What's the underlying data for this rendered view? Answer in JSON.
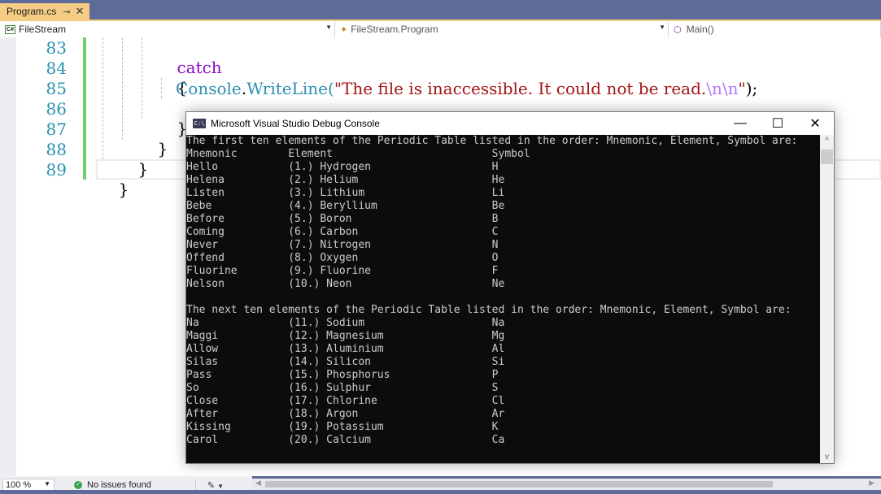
{
  "tab": {
    "label": "Program.cs",
    "pin_icon": "pin-icon",
    "close_icon": "close-icon"
  },
  "navbar": {
    "project": "FileStream",
    "class": "FileStream.Program",
    "member": "Main()"
  },
  "editor": {
    "line_numbers": [
      "83",
      "84",
      "85",
      "86",
      "87",
      "88",
      "89"
    ],
    "code": {
      "catch_kw": "catch",
      "open_brace": "{",
      "console_type": "Console",
      "dot": ".",
      "method": "WriteLine(",
      "string_text": "\"The file is inaccessible. It could not be read.",
      "escape_seq": "\\n\\n",
      "string_end": "\"",
      "tail": ");",
      "close_brace": "}"
    }
  },
  "console": {
    "title": "Microsoft Visual Studio Debug Console",
    "icon_text": "C:\\",
    "minimize": "—",
    "maximize": "☐",
    "close": "✕",
    "lines": [
      "The first ten elements of the Periodic Table listed in the order: Mnemonic, Element, Symbol are:",
      "Mnemonic        Element                         Symbol",
      "Hello           (1.) Hydrogen                   H",
      "Helena          (2.) Helium                     He",
      "Listen          (3.) Lithium                    Li",
      "Bebe            (4.) Beryllium                  Be",
      "Before          (5.) Boron                      B",
      "Coming          (6.) Carbon                     C",
      "Never           (7.) Nitrogen                   N",
      "Offend          (8.) Oxygen                     O",
      "Fluorine        (9.) Fluorine                   F",
      "Nelson          (10.) Neon                      Ne",
      "",
      "The next ten elements of the Periodic Table listed in the order: Mnemonic, Element, Symbol are:",
      "Na              (11.) Sodium                    Na",
      "Maggi           (12.) Magnesium                 Mg",
      "Allow           (13.) Aluminium                 Al",
      "Silas           (14.) Silicon                   Si",
      "Pass            (15.) Phosphorus                P",
      "So              (16.) Sulphur                   S",
      "Close           (17.) Chlorine                  Cl",
      "After           (18.) Argon                     Ar",
      "Kissing         (19.) Potassium                 K",
      "Carol           (20.) Calcium                   Ca"
    ]
  },
  "statusbar": {
    "zoom": "100 %",
    "issues": "No issues found"
  },
  "colors": {
    "accent": "#5d6b99",
    "tab_active": "#f5cc84",
    "keyword": "#8f08c4",
    "type": "#2b91af",
    "string": "#a31515",
    "escape": "#b776fb",
    "change_bar": "#6ed16e"
  }
}
